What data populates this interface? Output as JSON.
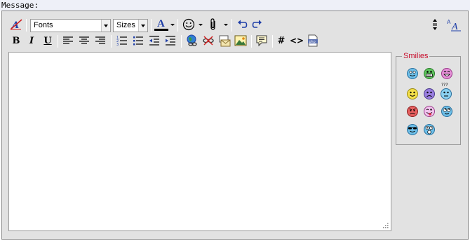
{
  "message_label": "Message:",
  "toolbar": {
    "font_select": "Fonts",
    "size_select": "Sizes",
    "bold_label": "B",
    "italic_label": "I",
    "underline_label": "U",
    "text_color_letter": "A",
    "hash_label": "#",
    "code_label": "<>",
    "php_label": "php",
    "font_size_small": "A",
    "font_size_large": "A"
  },
  "smilies": {
    "title": "Smilies",
    "confused_text": "???",
    "items": [
      "smile",
      "grin",
      "laugh",
      "happy",
      "sad",
      "confused",
      "mad",
      "tongue",
      "roll-eyes",
      "cool",
      "shocked"
    ]
  },
  "colors": {
    "label_bg": "#eef0f8",
    "editor_bg": "#e2e2e2",
    "smilies_title": "#c8102e",
    "icon_blue": "#1f3fa8"
  }
}
